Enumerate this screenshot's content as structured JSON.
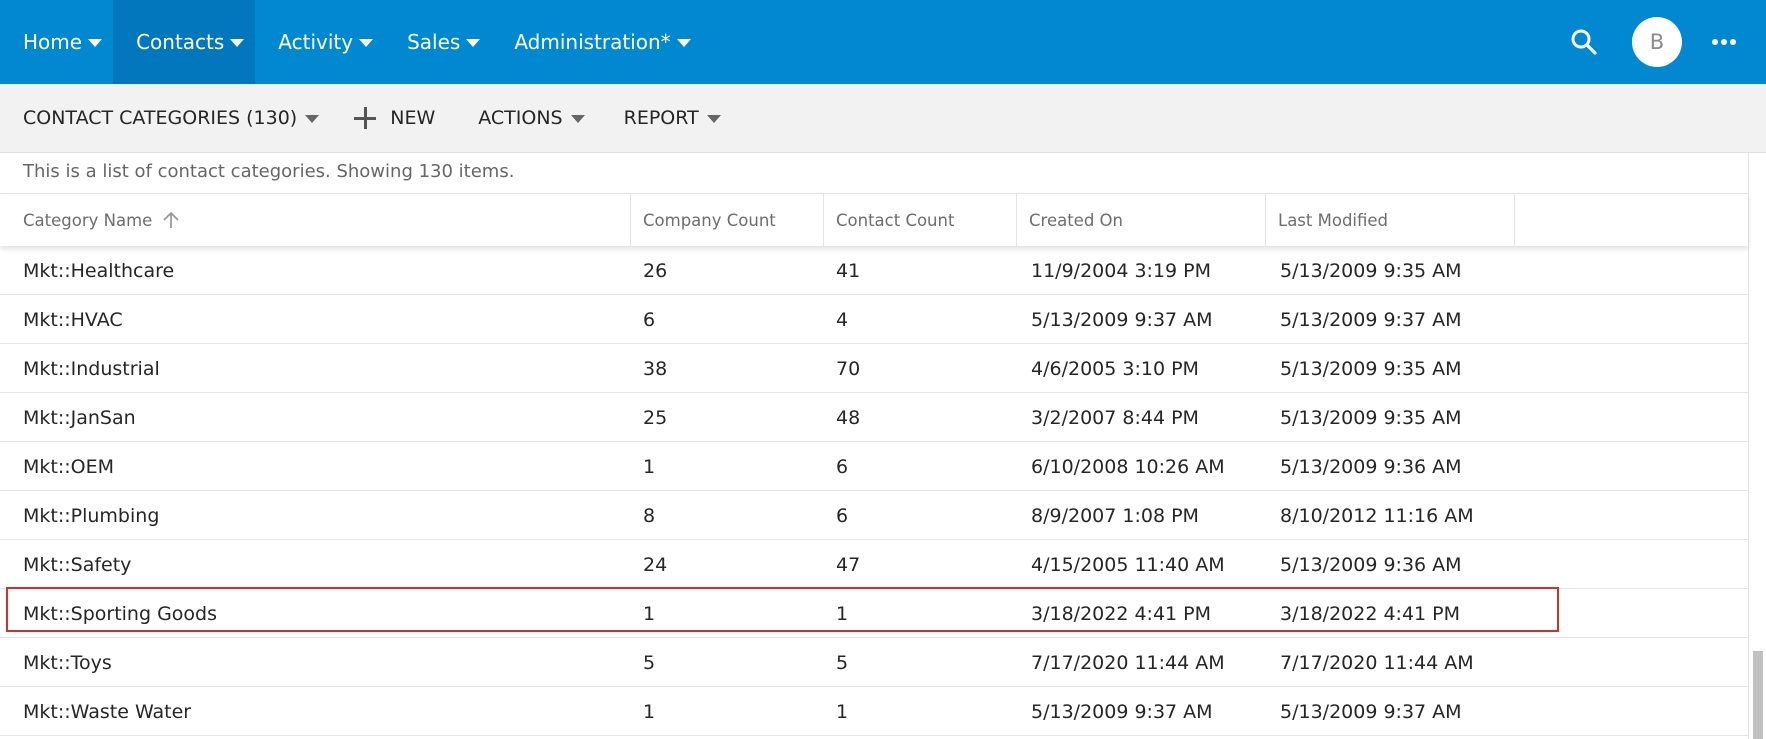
{
  "nav": {
    "items": [
      {
        "label": "Home"
      },
      {
        "label": "Contacts"
      },
      {
        "label": "Activity"
      },
      {
        "label": "Sales"
      },
      {
        "label": "Administration*"
      }
    ],
    "active_index": 1,
    "avatar_initial": "B",
    "search_icon": "search-icon",
    "more_icon": "more-horizontal-icon"
  },
  "toolbar": {
    "view_label": "CONTACT CATEGORIES (130)",
    "new_label": "NEW",
    "actions_label": "ACTIONS",
    "report_label": "REPORT"
  },
  "list": {
    "description": "This is a list of contact categories. Showing 130 items.",
    "columns": [
      "Category Name",
      "Company Count",
      "Contact Count",
      "Created On",
      "Last Modified"
    ],
    "sort_column": "Category Name",
    "sort_direction": "ascending",
    "rows": [
      [
        "Mkt::Healthcare",
        "26",
        "41",
        "11/9/2004 3:19 PM",
        "5/13/2009 9:35 AM"
      ],
      [
        "Mkt::HVAC",
        "6",
        "4",
        "5/13/2009 9:37 AM",
        "5/13/2009 9:37 AM"
      ],
      [
        "Mkt::Industrial",
        "38",
        "70",
        "4/6/2005 3:10 PM",
        "5/13/2009 9:35 AM"
      ],
      [
        "Mkt::JanSan",
        "25",
        "48",
        "3/2/2007 8:44 PM",
        "5/13/2009 9:35 AM"
      ],
      [
        "Mkt::OEM",
        "1",
        "6",
        "6/10/2008 10:26 AM",
        "5/13/2009 9:36 AM"
      ],
      [
        "Mkt::Plumbing",
        "8",
        "6",
        "8/9/2007 1:08 PM",
        "8/10/2012 11:16 AM"
      ],
      [
        "Mkt::Safety",
        "24",
        "47",
        "4/15/2005 11:40 AM",
        "5/13/2009 9:36 AM"
      ],
      [
        "Mkt::Sporting Goods",
        "1",
        "1",
        "3/18/2022 4:41 PM",
        "3/18/2022 4:41 PM"
      ],
      [
        "Mkt::Toys",
        "5",
        "5",
        "7/17/2020 11:44 AM",
        "7/17/2020 11:44 AM"
      ],
      [
        "Mkt::Waste Water",
        "1",
        "1",
        "5/13/2009 9:37 AM",
        "5/13/2009 9:37 AM"
      ]
    ],
    "highlighted_row_index": 7
  },
  "colors": {
    "nav_bg": "#0288d1",
    "nav_active_bg": "#0277bd",
    "toolbar_bg": "#f2f2f2",
    "highlight_border": "#d32f2f"
  }
}
